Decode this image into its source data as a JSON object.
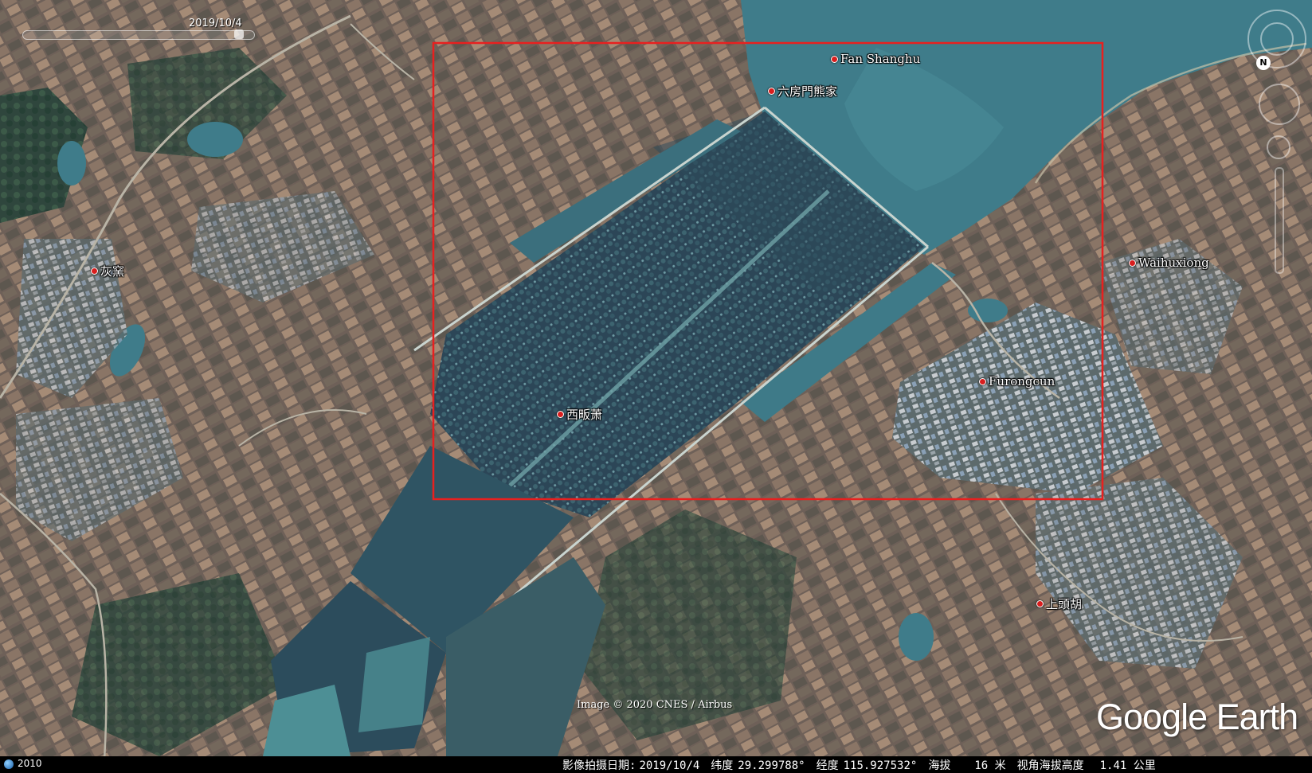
{
  "time_slider": {
    "date": "2019/10/4"
  },
  "placemarks": [
    {
      "label": "Fan Shanghu",
      "icon": "red-pin-icon"
    },
    {
      "label": "六房門熊家",
      "icon": "red-pin-icon"
    },
    {
      "label": "灰窯",
      "icon": "red-pin-icon"
    },
    {
      "label": "Waihuxiong",
      "icon": "red-pin-icon"
    },
    {
      "label": "Furongcun",
      "icon": "red-pin-icon"
    },
    {
      "label": "西畈萧",
      "icon": "red-pin-icon"
    },
    {
      "label": "上頭胡",
      "icon": "red-pin-icon"
    }
  ],
  "overlay": {
    "color": "#e8201f",
    "shape": "rectangle"
  },
  "credit": "Image © 2020 CNES / Airbus",
  "brand": "Google Earth",
  "status_bar": {
    "year": "2010",
    "imagery_date_label": "影像拍摄日期:",
    "imagery_date": "2019/10/4",
    "lat_label": "纬度",
    "lat": "29.299788°",
    "lon_label": "经度",
    "lon": "115.927532°",
    "elev_label": "海拔",
    "elev": "16 米",
    "eye_label": "视角海拔高度",
    "eye": "1.41 公里"
  },
  "navigation": {
    "north_label": "N"
  },
  "colors": {
    "water": "#3f7c8a",
    "field": "#7a6a5e",
    "vegetation": "#2d4a48",
    "wetland": "#2f4f66"
  }
}
